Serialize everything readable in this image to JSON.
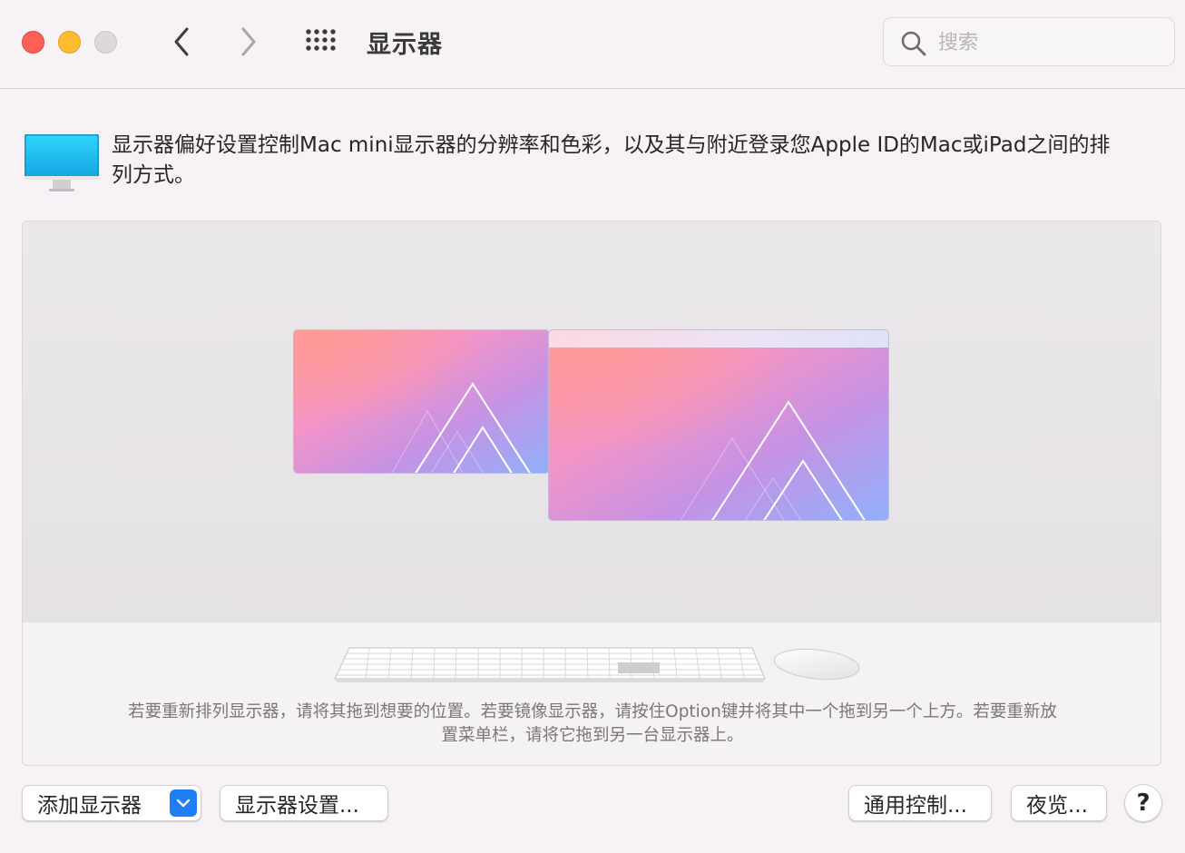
{
  "window": {
    "title": "显示器",
    "back_icon": "chevron-left-icon",
    "forward_icon": "chevron-right-icon",
    "grid_icon": "grid-icon"
  },
  "search": {
    "placeholder": "搜索",
    "value": "",
    "icon": "search-icon"
  },
  "description": {
    "icon": "monitor-icon",
    "text": "显示器偏好设置控制Mac mini显示器的分辨率和色彩，以及其与附近登录您Apple ID的Mac或iPad之间的排列方式。"
  },
  "arrangement": {
    "displays": [
      "display-1",
      "display-2-main"
    ],
    "hint": "若要重新排列显示器，请将其拖到想要的位置。若要镜像显示器，请按住Option键并将其中一个拖到另一个上方。若要重新放置菜单栏，请将它拖到另一台显示器上。"
  },
  "buttons": {
    "add_display": "添加显示器",
    "display_settings": "显示器设置...",
    "universal_control": "通用控制...",
    "night_shift": "夜览...",
    "help": "?"
  },
  "colors": {
    "traffic_red": "#fe5f57",
    "traffic_yellow": "#febc2e",
    "accent_blue": "#1f7df6"
  }
}
